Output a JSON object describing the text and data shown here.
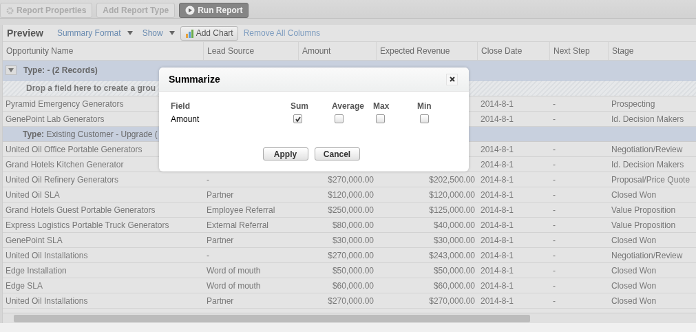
{
  "toolbar": {
    "buttons": [
      {
        "label": "Report Properties",
        "kind": "gear",
        "disabled": true
      },
      {
        "label": "Add Report Type",
        "kind": "plain",
        "disabled": true
      },
      {
        "label": "Run Report",
        "kind": "run",
        "disabled": false
      }
    ]
  },
  "preview": {
    "title": "Preview",
    "menus": [
      "Summary Format",
      "Show"
    ],
    "add_chart": "Add Chart",
    "remove_link": "Remove All Columns"
  },
  "table": {
    "columns": [
      "Opportunity Name",
      "Lead Source",
      "Amount",
      "Expected Revenue",
      "Close Date",
      "Next Step",
      "Stage"
    ],
    "rows": [
      {
        "kind": "group",
        "expanded": true,
        "label": "Type: - (2 Records)"
      },
      {
        "kind": "drop",
        "label": "Drop a field here to create a grou"
      },
      {
        "kind": "data",
        "cells": [
          "Pyramid Emergency Generators",
          null,
          null,
          null,
          "2014-8-1",
          "-",
          "Prospecting"
        ]
      },
      {
        "kind": "data",
        "cells": [
          "GenePoint Lab Generators",
          null,
          null,
          null,
          "2014-8-1",
          "-",
          "Id. Decision Makers"
        ]
      },
      {
        "kind": "subgroup",
        "label": "**Type:** Existing Customer - Upgrade ("
      },
      {
        "kind": "data",
        "cells": [
          "United Oil Office Portable Generators",
          null,
          null,
          null,
          "2014-8-1",
          "-",
          "Negotiation/Review"
        ]
      },
      {
        "kind": "data",
        "cells": [
          "Grand Hotels Kitchen Generator",
          null,
          null,
          null,
          "2014-8-1",
          "-",
          "Id. Decision Makers"
        ]
      },
      {
        "kind": "data",
        "cells": [
          "United Oil Refinery Generators",
          "-",
          "$270,000.00",
          "$202,500.00",
          "2014-8-1",
          "-",
          "Proposal/Price Quote"
        ]
      },
      {
        "kind": "data",
        "cells": [
          "United Oil SLA",
          "Partner",
          "$120,000.00",
          "$120,000.00",
          "2014-8-1",
          "-",
          "Closed Won"
        ]
      },
      {
        "kind": "data",
        "cells": [
          "Grand Hotels Guest Portable Generators",
          "Employee Referral",
          "$250,000.00",
          "$125,000.00",
          "2014-8-1",
          "-",
          "Value Proposition"
        ]
      },
      {
        "kind": "data",
        "cells": [
          "Express Logistics Portable Truck Generators",
          "External Referral",
          "$80,000.00",
          "$40,000.00",
          "2014-8-1",
          "-",
          "Value Proposition"
        ]
      },
      {
        "kind": "data",
        "cells": [
          "GenePoint SLA",
          "Partner",
          "$30,000.00",
          "$30,000.00",
          "2014-8-1",
          "-",
          "Closed Won"
        ]
      },
      {
        "kind": "data",
        "cells": [
          "United Oil Installations",
          "-",
          "$270,000.00",
          "$243,000.00",
          "2014-8-1",
          "-",
          "Negotiation/Review"
        ]
      },
      {
        "kind": "data",
        "cells": [
          "Edge Installation",
          "Word of mouth",
          "$50,000.00",
          "$50,000.00",
          "2014-8-1",
          "-",
          "Closed Won"
        ]
      },
      {
        "kind": "data",
        "cells": [
          "Edge SLA",
          "Word of mouth",
          "$60,000.00",
          "$60,000.00",
          "2014-8-1",
          "-",
          "Closed Won"
        ]
      },
      {
        "kind": "data",
        "cells": [
          "United Oil Installations",
          "Partner",
          "$270,000.00",
          "$270,000.00",
          "2014-8-1",
          "-",
          "Closed Won"
        ]
      }
    ]
  },
  "dialog": {
    "title": "Summarize",
    "columns": [
      "Field",
      "Sum",
      "Average",
      "Max",
      "Min"
    ],
    "fields": [
      {
        "name": "Amount",
        "options": [
          {
            "checked": true
          },
          {
            "checked": false
          },
          {
            "checked": false
          },
          {
            "checked": false
          }
        ]
      }
    ],
    "buttons": [
      "Apply",
      "Cancel"
    ]
  }
}
